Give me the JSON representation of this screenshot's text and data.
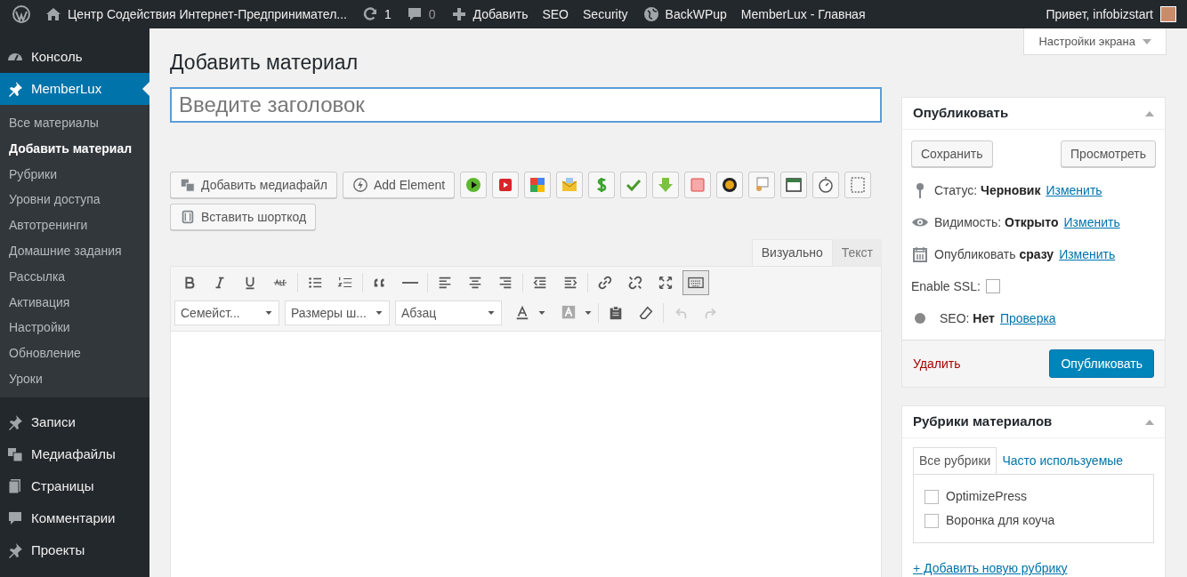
{
  "admin_bar": {
    "items": [
      {
        "kind": "logo"
      },
      {
        "kind": "home",
        "label": "Центр Содействия Интернет-Предпринимател..."
      },
      {
        "kind": "updates",
        "label": "1"
      },
      {
        "kind": "comments",
        "label": "0"
      },
      {
        "kind": "new",
        "label": "Добавить"
      },
      {
        "kind": "text",
        "label": "SEO"
      },
      {
        "kind": "text",
        "label": "Security"
      },
      {
        "kind": "backup",
        "label": "BackWPup"
      },
      {
        "kind": "text",
        "label": "MemberLux - Главная"
      }
    ],
    "greeting": "Привет, infobizstart"
  },
  "sidebar": {
    "items": [
      {
        "kind": "gauge",
        "label": "Консоль",
        "selected": false
      },
      {
        "kind": "pin",
        "label": "MemberLux",
        "selected": true,
        "children": [
          {
            "label": "Все материалы",
            "selected": false
          },
          {
            "label": "Добавить материал",
            "selected": true
          },
          {
            "label": "Рубрики",
            "selected": false
          },
          {
            "label": "Уровни доступа",
            "selected": false
          },
          {
            "label": "Автотренинги",
            "selected": false
          },
          {
            "label": "Домашние задания",
            "selected": false
          },
          {
            "label": "Рассылка",
            "selected": false
          },
          {
            "label": "Активация",
            "selected": false
          },
          {
            "label": "Настройки",
            "selected": false
          },
          {
            "label": "Обновление",
            "selected": false
          },
          {
            "label": "Уроки",
            "selected": false
          }
        ]
      },
      {
        "kind": "pin",
        "label": "Записи",
        "selected": false
      },
      {
        "kind": "media",
        "label": "Медиафайлы",
        "selected": false
      },
      {
        "kind": "pages",
        "label": "Страницы",
        "selected": false
      },
      {
        "kind": "comment",
        "label": "Комментарии",
        "selected": false
      },
      {
        "kind": "pin",
        "label": "Проекты",
        "selected": false
      }
    ]
  },
  "screen_options": "Настройки экрана",
  "page_title": "Добавить материал",
  "title_field": {
    "placeholder": "Введите заголовок"
  },
  "media_buttons": [
    {
      "kind": "media",
      "label": "Добавить медиафайл"
    },
    {
      "kind": "element",
      "label": "Add Element"
    },
    {
      "kind": "shortcode",
      "label": "Вставить шорткод"
    }
  ],
  "editor_tabs": [
    {
      "label": "Визуально",
      "selected": true
    },
    {
      "label": "Текст",
      "selected": false
    }
  ],
  "editor_dropdowns": [
    "Семейст...",
    "Размеры ш...",
    "Абзац"
  ],
  "publish_box": {
    "title": "Опубликовать",
    "save": "Сохранить",
    "preview": "Просмотреть",
    "rows": [
      {
        "kind": "status",
        "label": "Статус:",
        "value": "Черновик",
        "link": "Изменить"
      },
      {
        "kind": "visibility",
        "label": "Видимость:",
        "value": "Открыто",
        "link": "Изменить"
      },
      {
        "kind": "schedule",
        "label": "Опубликовать",
        "value": "сразу",
        "link": "Изменить"
      },
      {
        "kind": "checkbox",
        "label": "Enable SSL:",
        "checked": false
      },
      {
        "kind": "seo",
        "label": "SEO:",
        "value": "Нет",
        "link": "Проверка"
      }
    ],
    "delete": "Удалить",
    "publish": "Опубликовать"
  },
  "categories_box": {
    "title": "Рубрики материалов",
    "tabs": [
      {
        "label": "Все рубрики",
        "selected": true
      },
      {
        "label": "Часто используемые",
        "selected": false
      }
    ],
    "items": [
      {
        "label": "OptimizePress",
        "checked": false
      },
      {
        "label": "Воронка для коуча",
        "checked": false
      }
    ],
    "add_link": "+ Добавить новую рубрику"
  }
}
